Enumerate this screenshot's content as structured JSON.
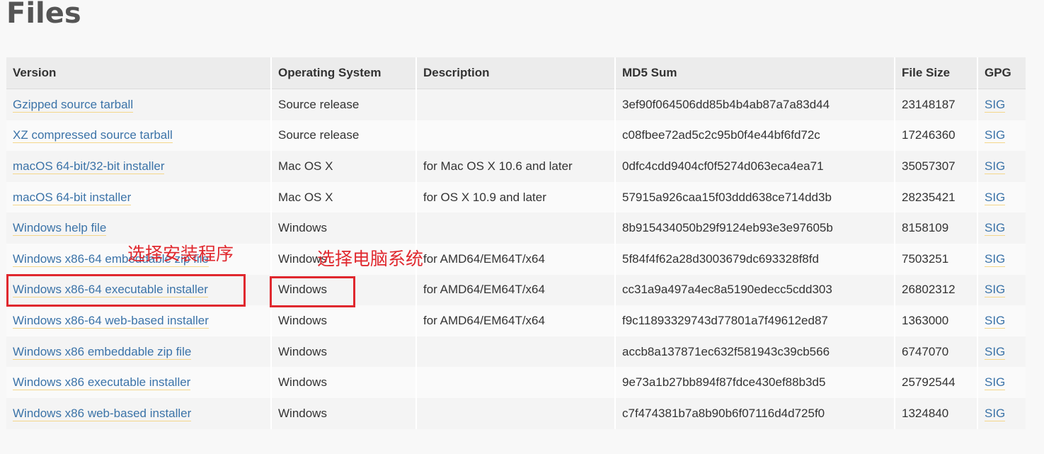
{
  "page": {
    "title": "Files"
  },
  "table": {
    "headers": [
      "Version",
      "Operating System",
      "Description",
      "MD5 Sum",
      "File Size",
      "GPG"
    ],
    "rows": [
      {
        "version": "Gzipped source tarball",
        "os": "Source release",
        "description": "",
        "md5": "3ef90f064506dd85b4b4ab87a7a83d44",
        "size": "23148187",
        "gpg": "SIG"
      },
      {
        "version": "XZ compressed source tarball",
        "os": "Source release",
        "description": "",
        "md5": "c08fbee72ad5c2c95b0f4e44bf6fd72c",
        "size": "17246360",
        "gpg": "SIG"
      },
      {
        "version": "macOS 64-bit/32-bit installer",
        "os": "Mac OS X",
        "description": "for Mac OS X 10.6 and later",
        "md5": "0dfc4cdd9404cf0f5274d063eca4ea71",
        "size": "35057307",
        "gpg": "SIG"
      },
      {
        "version": "macOS 64-bit installer",
        "os": "Mac OS X",
        "description": "for OS X 10.9 and later",
        "md5": "57915a926caa15f03ddd638ce714dd3b",
        "size": "28235421",
        "gpg": "SIG"
      },
      {
        "version": "Windows help file",
        "os": "Windows",
        "description": "",
        "md5": "8b915434050b29f9124eb93e3e97605b",
        "size": "8158109",
        "gpg": "SIG"
      },
      {
        "version": "Windows x86-64 embeddable zip file",
        "os": "Windows",
        "description": "for AMD64/EM64T/x64",
        "md5": "5f84f4f62a28d3003679dc693328f8fd",
        "size": "7503251",
        "gpg": "SIG"
      },
      {
        "version": "Windows x86-64 executable installer",
        "os": "Windows",
        "description": "for AMD64/EM64T/x64",
        "md5": "cc31a9a497a4ec8a5190edecc5cdd303",
        "size": "26802312",
        "gpg": "SIG"
      },
      {
        "version": "Windows x86-64 web-based installer",
        "os": "Windows",
        "description": "for AMD64/EM64T/x64",
        "md5": "f9c11893329743d77801a7f49612ed87",
        "size": "1363000",
        "gpg": "SIG"
      },
      {
        "version": "Windows x86 embeddable zip file",
        "os": "Windows",
        "description": "",
        "md5": "accb8a137871ec632f581943c39cb566",
        "size": "6747070",
        "gpg": "SIG"
      },
      {
        "version": "Windows x86 executable installer",
        "os": "Windows",
        "description": "",
        "md5": "9e73a1b27bb894f87fdce430ef88b3d5",
        "size": "25792544",
        "gpg": "SIG"
      },
      {
        "version": "Windows x86 web-based installer",
        "os": "Windows",
        "description": "",
        "md5": "c7f474381b7a8b90b6f07116d4d725f0",
        "size": "1324840",
        "gpg": "SIG"
      }
    ]
  },
  "annotations": {
    "select_installer": "选择安装程序",
    "select_os": "选择电脑系统",
    "color": "#e0282e"
  },
  "colors": {
    "link": "#3b73a8",
    "link_underline": "#f4d68a",
    "title": "#555555"
  }
}
